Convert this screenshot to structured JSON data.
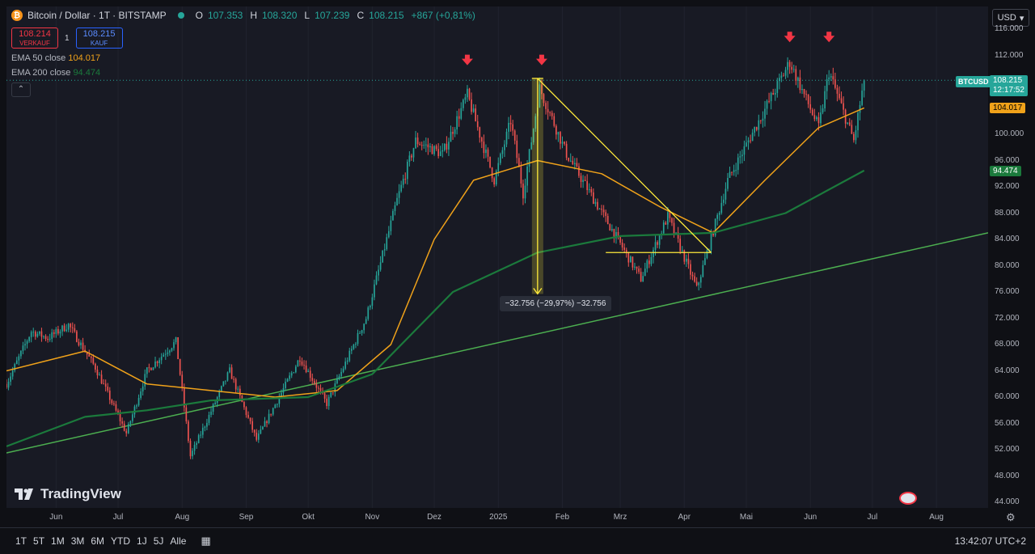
{
  "symbol": {
    "title": "Bitcoin / Dollar · 1T · BITSTAMP",
    "ohlc": [
      {
        "label": "O",
        "value": "107.353"
      },
      {
        "label": "H",
        "value": "108.320"
      },
      {
        "label": "L",
        "value": "107.239"
      },
      {
        "label": "C",
        "value": "108.215"
      }
    ],
    "change": "+867 (+0,81%)",
    "sell_price": "108.214",
    "sell_label": "VERKAUF",
    "buy_price": "108.215",
    "buy_label": "KAUF",
    "quantity": "1",
    "ticker": "BTCUSD",
    "countdown": "12:17:52"
  },
  "indicators": {
    "ema50_label": "EMA 50 close",
    "ema50_value": "104.017",
    "ema200_label": "EMA 200 close",
    "ema200_value": "94.474",
    "collapse_glyph": "⌃"
  },
  "currency": {
    "label": "USD",
    "icon": "chevron-down-icon"
  },
  "brand": {
    "name": "TradingView"
  },
  "time_ranges": [
    "1T",
    "5T",
    "1M",
    "3M",
    "6M",
    "YTD",
    "1J",
    "5J",
    "Alle"
  ],
  "clock": "13:42:07 UTC+2",
  "colors": {
    "up": "#26a69a",
    "down": "#ef5350",
    "ema50": "#f0a21a",
    "ema200": "#1b7a3c",
    "trend": "#4caf50",
    "drawing": "#ffeb3b",
    "marker": "#f23645"
  },
  "chart_data": {
    "type": "candlestick",
    "y_axis": {
      "range": [
        44000,
        116000
      ],
      "ticks": [
        116000,
        112000,
        108000,
        104000,
        100000,
        96000,
        92000,
        88000,
        84000,
        80000,
        76000,
        72000,
        68000,
        64000,
        60000,
        56000,
        52000,
        48000,
        44000
      ],
      "tick_labels": [
        "116.000",
        "112.000",
        "108.000",
        "104.000",
        "100.000",
        "96.000",
        "92.000",
        "88.000",
        "84.000",
        "80.000",
        "76.000",
        "72.000",
        "68.000",
        "64.000",
        "60.000",
        "56.000",
        "52.000",
        "48.000",
        "44.000"
      ]
    },
    "x_axis": {
      "range": [
        "2024-05-08",
        "2025-08-26"
      ],
      "ticks": [
        "2024-06-01",
        "2024-07-01",
        "2024-08-01",
        "2024-09-01",
        "2024-10-01",
        "2024-11-01",
        "2024-12-01",
        "2025-01-01",
        "2025-02-01",
        "2025-03-01",
        "2025-04-01",
        "2025-05-01",
        "2025-06-01",
        "2025-07-01",
        "2025-08-01"
      ],
      "tick_labels": [
        "Jun",
        "Jul",
        "Aug",
        "Sep",
        "Okt",
        "Nov",
        "Dez",
        "2025",
        "Feb",
        "Mrz",
        "Apr",
        "Mai",
        "Jun",
        "Jul",
        "Aug"
      ]
    },
    "price_path": [
      [
        "2024-05-08",
        62000
      ],
      [
        "2024-05-20",
        70000
      ],
      [
        "2024-05-28",
        69000
      ],
      [
        "2024-06-07",
        71000
      ],
      [
        "2024-06-20",
        64500
      ],
      [
        "2024-07-05",
        54500
      ],
      [
        "2024-07-15",
        64000
      ],
      [
        "2024-07-29",
        68500
      ],
      [
        "2024-08-05",
        51000
      ],
      [
        "2024-08-24",
        64000
      ],
      [
        "2024-09-06",
        53500
      ],
      [
        "2024-09-27",
        66000
      ],
      [
        "2024-10-10",
        59000
      ],
      [
        "2024-10-29",
        72000
      ],
      [
        "2024-11-13",
        90000
      ],
      [
        "2024-11-22",
        99000
      ],
      [
        "2024-12-05",
        97000
      ],
      [
        "2024-12-17",
        106000
      ],
      [
        "2024-12-30",
        93000
      ],
      [
        "2025-01-07",
        102000
      ],
      [
        "2025-01-13",
        91000
      ],
      [
        "2025-01-21",
        107000
      ],
      [
        "2025-02-03",
        97000
      ],
      [
        "2025-02-24",
        86000
      ],
      [
        "2025-03-11",
        78000
      ],
      [
        "2025-03-24",
        87500
      ],
      [
        "2025-04-07",
        76500
      ],
      [
        "2025-04-22",
        93000
      ],
      [
        "2025-05-22",
        111000
      ],
      [
        "2025-06-05",
        101000
      ],
      [
        "2025-06-10",
        109500
      ],
      [
        "2025-06-22",
        99000
      ],
      [
        "2025-06-27",
        108215
      ]
    ],
    "series": [
      {
        "name": "EMA 50 close",
        "points": [
          [
            "2024-05-08",
            64000
          ],
          [
            "2024-06-15",
            67000
          ],
          [
            "2024-07-15",
            62000
          ],
          [
            "2024-08-15",
            61000
          ],
          [
            "2024-09-15",
            60000
          ],
          [
            "2024-10-15",
            61000
          ],
          [
            "2024-11-10",
            68000
          ],
          [
            "2024-12-01",
            84000
          ],
          [
            "2024-12-20",
            93000
          ],
          [
            "2025-01-20",
            96000
          ],
          [
            "2025-02-20",
            94000
          ],
          [
            "2025-03-20",
            89000
          ],
          [
            "2025-04-15",
            85000
          ],
          [
            "2025-05-10",
            93000
          ],
          [
            "2025-06-05",
            101000
          ],
          [
            "2025-06-27",
            104017
          ]
        ]
      },
      {
        "name": "EMA 200 close",
        "points": [
          [
            "2024-05-08",
            52500
          ],
          [
            "2024-06-15",
            57000
          ],
          [
            "2024-07-15",
            58000
          ],
          [
            "2024-08-15",
            59500
          ],
          [
            "2024-10-01",
            60000
          ],
          [
            "2024-11-01",
            63500
          ],
          [
            "2024-12-10",
            76000
          ],
          [
            "2025-01-20",
            82000
          ],
          [
            "2025-03-01",
            84500
          ],
          [
            "2025-04-15",
            85000
          ],
          [
            "2025-05-20",
            88000
          ],
          [
            "2025-06-27",
            94474
          ]
        ]
      }
    ],
    "drawings": {
      "trendline": [
        [
          "2024-05-08",
          51500
        ],
        [
          "2025-08-26",
          85000
        ]
      ],
      "triangle_upper": [
        [
          "2025-01-20",
          108500
        ],
        [
          "2025-04-14",
          82000
        ]
      ],
      "triangle_lower": [
        [
          "2025-02-22",
          82000
        ],
        [
          "2025-04-14",
          82000
        ]
      ],
      "measure": {
        "from": [
          "2025-01-20",
          108500
        ],
        "to": [
          "2025-01-20",
          75700
        ],
        "label": "−32.756 (−29,97%) −32.756"
      },
      "markers": [
        [
          "2024-12-17",
          111000
        ],
        [
          "2025-01-22",
          111000
        ],
        [
          "2025-05-22",
          114500
        ],
        [
          "2025-06-10",
          114500
        ]
      ]
    }
  }
}
